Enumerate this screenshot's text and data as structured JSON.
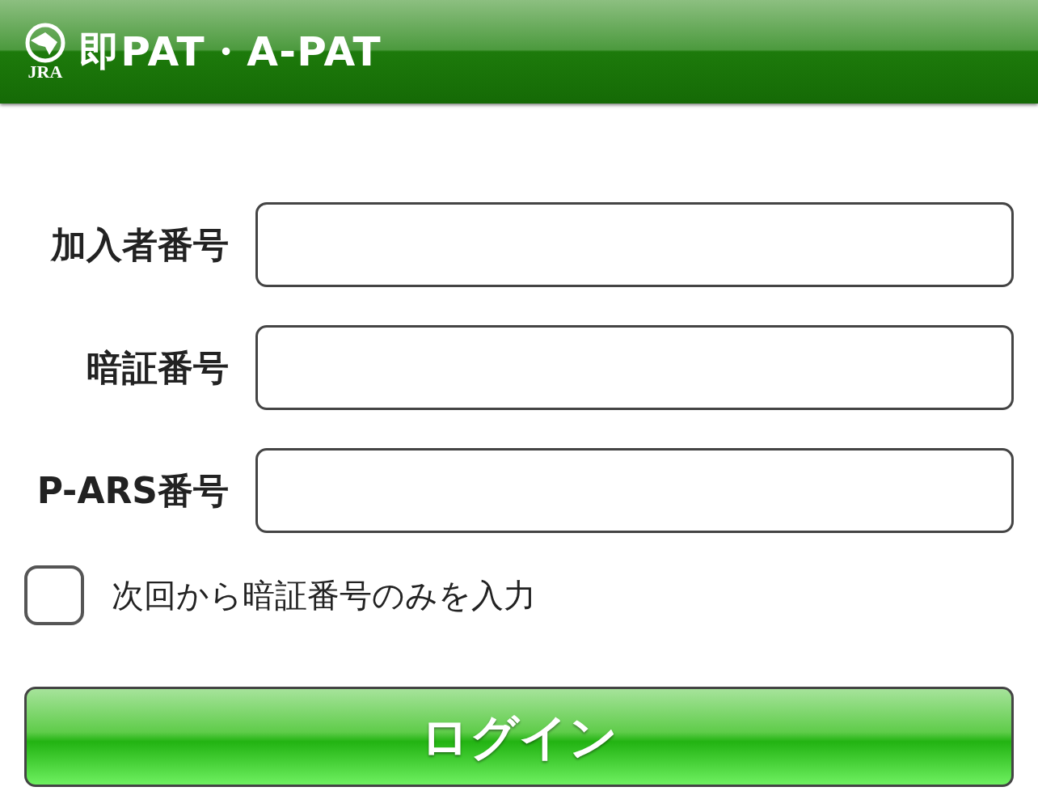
{
  "header": {
    "logo_text": "JRA",
    "title": "即PAT・A-PAT"
  },
  "fields": [
    {
      "label": "加入者番号"
    },
    {
      "label": "暗証番号"
    },
    {
      "label": "P-ARS番号"
    }
  ],
  "remember": {
    "label": "次回から暗証番号のみを入力",
    "checked": false
  },
  "login_button": "ログイン"
}
